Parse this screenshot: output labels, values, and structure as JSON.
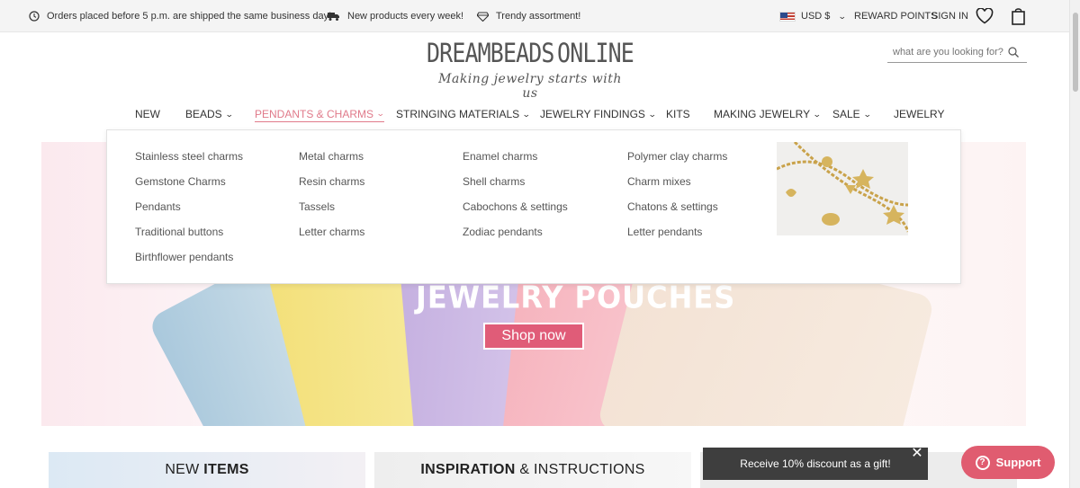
{
  "topbar": {
    "shipping_text": "Orders placed before 5 p.m. are shipped the same business day!",
    "new_products_text": "New products every week!",
    "assortment_text": "Trendy assortment!",
    "currency": "USD $",
    "reward_points": "REWARD POINTS",
    "sign_in": "SIGN IN"
  },
  "header": {
    "logo_left": "DREAMBEADS",
    "logo_right": "ONLINE",
    "tagline": "Making jewelry starts with us",
    "search_placeholder": "what are you looking for?"
  },
  "nav": {
    "items": [
      {
        "label": "NEW",
        "has_dropdown": false
      },
      {
        "label": "BEADS",
        "has_dropdown": true
      },
      {
        "label": "PENDANTS & CHARMS",
        "has_dropdown": true,
        "active": true
      },
      {
        "label": "STRINGING MATERIALS",
        "has_dropdown": true
      },
      {
        "label": "JEWELRY FINDINGS",
        "has_dropdown": true
      },
      {
        "label": "KITS",
        "has_dropdown": false
      },
      {
        "label": "MAKING JEWELRY",
        "has_dropdown": true
      },
      {
        "label": "SALE",
        "has_dropdown": true
      },
      {
        "label": "JEWELRY",
        "has_dropdown": false
      }
    ]
  },
  "dropdown": {
    "columns": [
      [
        "Stainless steel charms",
        "Gemstone Charms",
        "Pendants",
        "Traditional buttons",
        "Birthflower pendants"
      ],
      [
        "Metal charms",
        "Resin charms",
        "Tassels",
        "Letter charms"
      ],
      [
        "Enamel charms",
        "Shell charms",
        "Cabochons & settings",
        "Zodiac pendants"
      ],
      [
        "Polymer clay charms",
        "Charm mixes",
        "Chatons & settings",
        "Letter pendants"
      ]
    ]
  },
  "banner": {
    "title": "JEWELRY POUCHES",
    "button": "Shop now"
  },
  "tiles": {
    "new_items_a": "NEW ",
    "new_items_b": "ITEMS",
    "inspiration_a": "INSPIRATION",
    "inspiration_b": " & INSTRUCTIONS"
  },
  "toast": {
    "text": "Receive 10% discount as a gift!",
    "close": "✕"
  },
  "support": {
    "label": "Support",
    "icon": "?"
  },
  "colors": {
    "accent": "#e05c70",
    "nav_active": "#e07a8a",
    "toast_bg": "#3e3e3e"
  }
}
